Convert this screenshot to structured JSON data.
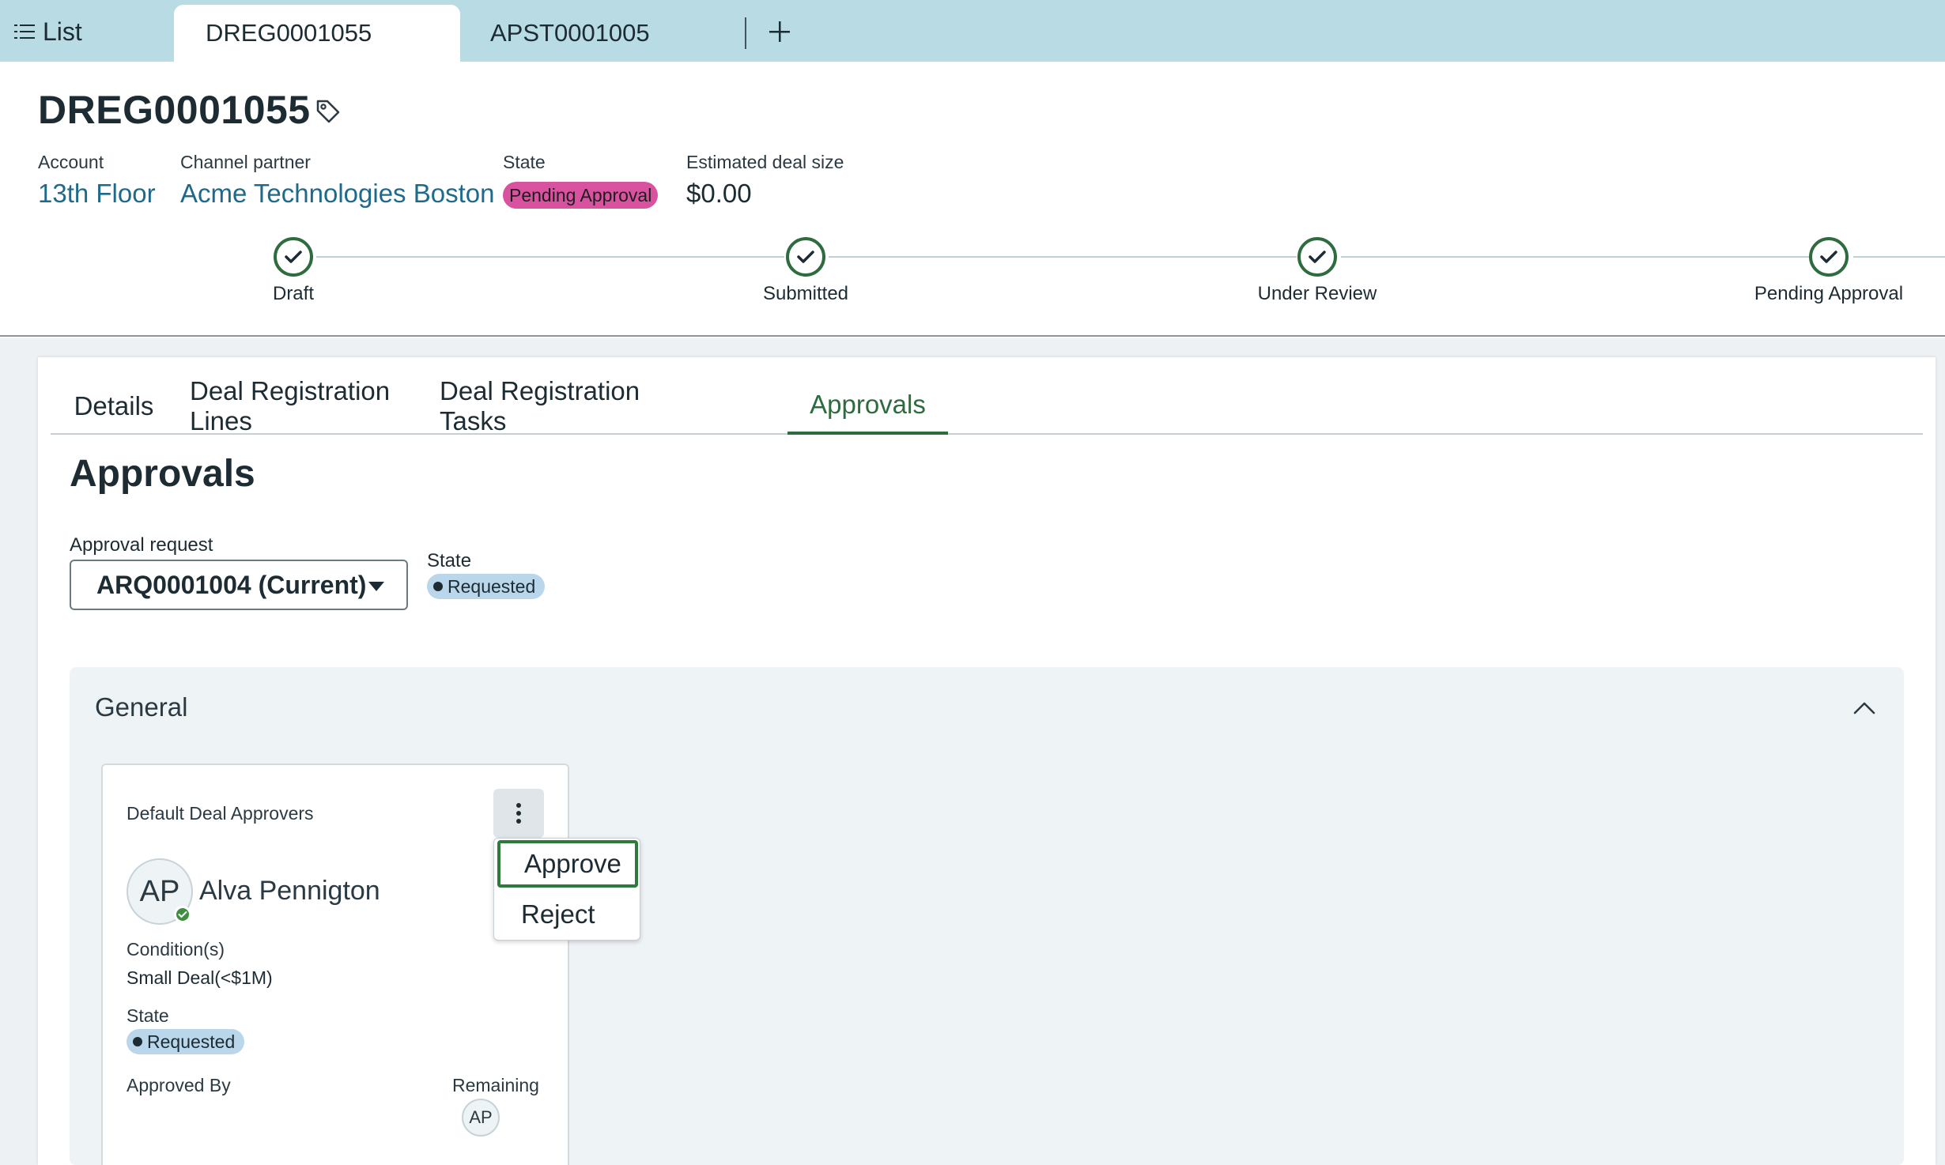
{
  "topbar": {
    "list_label": "List",
    "tabs": [
      {
        "label": "DREG0001055",
        "active": true
      },
      {
        "label": "APST0001005",
        "active": false
      }
    ]
  },
  "record": {
    "title": "DREG0001055",
    "fields": {
      "account_label": "Account",
      "account_value": "13th Floor",
      "partner_label": "Channel partner",
      "partner_value": "Acme Technologies Boston",
      "state_label": "State",
      "state_value": "Pending Approval",
      "deal_label": "Estimated deal size",
      "deal_value": "$0.00"
    },
    "stages": [
      "Draft",
      "Submitted",
      "Under Review",
      "Pending Approval"
    ]
  },
  "tabs": [
    "Details",
    "Deal Registration Lines",
    "Deal Registration Tasks",
    "Approvals"
  ],
  "approvals": {
    "heading": "Approvals",
    "request_label": "Approval request",
    "request_value": "ARQ0001004 (Current)",
    "state_label": "State",
    "state_value": "Requested"
  },
  "general": {
    "title": "General",
    "card": {
      "title": "Default Deal Approvers",
      "avatar_initials": "AP",
      "approver_name": "Alva Pennigton",
      "conditions_label": "Condition(s)",
      "conditions_value": "Small Deal(<$1M)",
      "state_label": "State",
      "state_value": "Requested",
      "approved_by_label": "Approved By",
      "remaining_label": "Remaining",
      "remaining_initials": "AP"
    },
    "menu": [
      "Approve",
      "Reject"
    ]
  },
  "colors": {
    "topbar": "#b9dbe4",
    "accent_green": "#2e6b3e",
    "link_blue": "#1f6a8a",
    "pending_pink": "#d9529f",
    "requested_blue": "#b9d6ea"
  },
  "icons": [
    "list-icon",
    "plus-icon",
    "tag-icon",
    "check-icon",
    "chevron-down-icon",
    "chevron-up-icon",
    "kebab-icon",
    "presence-check-icon"
  ]
}
